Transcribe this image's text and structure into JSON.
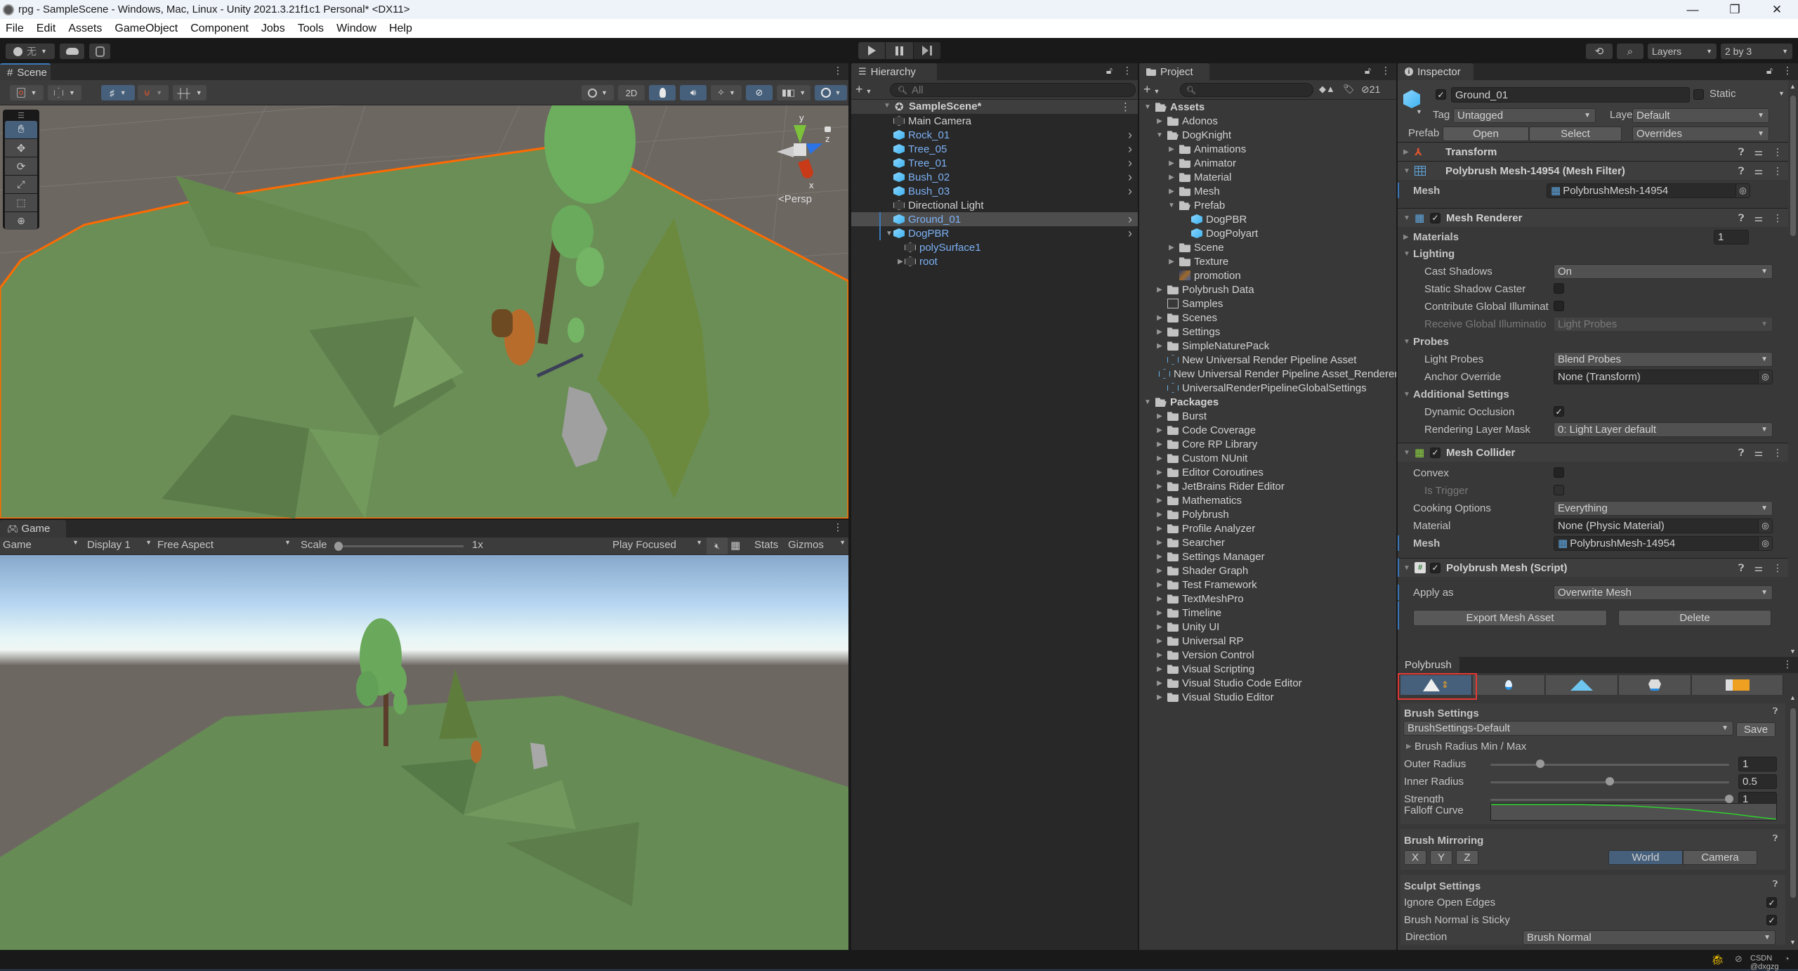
{
  "window": {
    "title": "rpg - SampleScene - Windows, Mac, Linux - Unity 2021.3.21f1c1 Personal* <DX11>",
    "controls": {
      "minimize": "—",
      "maximize": "❐",
      "close": "✕"
    }
  },
  "menu": [
    "File",
    "Edit",
    "Assets",
    "GameObject",
    "Component",
    "Jobs",
    "Tools",
    "Window",
    "Help"
  ],
  "toolbar": {
    "account_label": "无",
    "play_icon": "play-icon",
    "pause_icon": "pause-icon",
    "step_icon": "step-icon",
    "layers_label": "Layers",
    "layout_label": "2 by 3"
  },
  "scene": {
    "tab_label": "Scene",
    "mode_2d": "2D",
    "persp_label": "<Persp",
    "gizmo_axes": {
      "x": "x",
      "y": "y",
      "z": "z"
    },
    "tools": [
      "hand-tool",
      "move-tool",
      "rotate-tool",
      "scale-tool",
      "rect-tool",
      "transform-tool"
    ],
    "active_tool": "hand-tool",
    "selection_outline_color": "#ff6a00",
    "ground_color": "#6a8e56",
    "background_color": "#6d6762"
  },
  "game": {
    "tab_label": "Game",
    "view_select": "Game",
    "display_select": "Display 1",
    "aspect_select": "Free Aspect",
    "scale_label": "Scale",
    "scale_value": "1x",
    "scale_fraction": 0.0,
    "play_mode": "Play Focused",
    "stats_label": "Stats",
    "gizmos_label": "Gizmos"
  },
  "hierarchy": {
    "tab_label": "Hierarchy",
    "search_placeholder": "All",
    "scene_name": "SampleScene*",
    "items": [
      {
        "label": "Main Camera",
        "prefab": false,
        "depth": 1
      },
      {
        "label": "Rock_01",
        "prefab": true,
        "depth": 1,
        "has_arrow": true
      },
      {
        "label": "Tree_05",
        "prefab": true,
        "depth": 1,
        "has_arrow": true
      },
      {
        "label": "Tree_01",
        "prefab": true,
        "depth": 1,
        "has_arrow": true
      },
      {
        "label": "Bush_02",
        "prefab": true,
        "depth": 1,
        "has_arrow": true
      },
      {
        "label": "Bush_03",
        "prefab": true,
        "depth": 1,
        "has_arrow": true
      },
      {
        "label": "Directional Light",
        "prefab": false,
        "depth": 1
      },
      {
        "label": "Ground_01",
        "prefab": true,
        "depth": 1,
        "has_arrow": true,
        "selected": true
      },
      {
        "label": "DogPBR",
        "prefab": true,
        "depth": 1,
        "has_arrow": true,
        "expanded": true
      },
      {
        "label": "polySurface1",
        "prefab": false,
        "depth": 2,
        "blue": true
      },
      {
        "label": "root",
        "prefab": false,
        "depth": 2,
        "blue": true,
        "collapsed": true
      }
    ]
  },
  "project": {
    "tab_label": "Project",
    "search_placeholder": "",
    "hidden_count": "21",
    "tree": [
      {
        "label": "Assets",
        "depth": 0,
        "type": "folder-open",
        "bold": true,
        "arrow": "down"
      },
      {
        "label": "Adonos",
        "depth": 1,
        "type": "folder",
        "arrow": "right"
      },
      {
        "label": "DogKnight",
        "depth": 1,
        "type": "folder-open",
        "arrow": "down"
      },
      {
        "label": "Animations",
        "depth": 2,
        "type": "folder",
        "arrow": "right"
      },
      {
        "label": "Animator",
        "depth": 2,
        "type": "folder",
        "arrow": "right"
      },
      {
        "label": "Material",
        "depth": 2,
        "type": "folder",
        "arrow": "right"
      },
      {
        "label": "Mesh",
        "depth": 2,
        "type": "folder",
        "arrow": "right"
      },
      {
        "label": "Prefab",
        "depth": 2,
        "type": "folder-open",
        "arrow": "down"
      },
      {
        "label": "DogPBR",
        "depth": 3,
        "type": "prefab"
      },
      {
        "label": "DogPolyart",
        "depth": 3,
        "type": "prefab"
      },
      {
        "label": "Scene",
        "depth": 2,
        "type": "folder",
        "arrow": "right"
      },
      {
        "label": "Texture",
        "depth": 2,
        "type": "folder",
        "arrow": "right"
      },
      {
        "label": "promotion",
        "depth": 2,
        "type": "image"
      },
      {
        "label": "Polybrush Data",
        "depth": 1,
        "type": "folder",
        "arrow": "right"
      },
      {
        "label": "Samples",
        "depth": 1,
        "type": "folder-empty"
      },
      {
        "label": "Scenes",
        "depth": 1,
        "type": "folder",
        "arrow": "right"
      },
      {
        "label": "Settings",
        "depth": 1,
        "type": "folder",
        "arrow": "right"
      },
      {
        "label": "SimpleNaturePack",
        "depth": 1,
        "type": "folder",
        "arrow": "right"
      },
      {
        "label": "New Universal Render Pipeline Asset",
        "depth": 1,
        "type": "urp"
      },
      {
        "label": "New Universal Render Pipeline Asset_Renderer",
        "depth": 1,
        "type": "urp"
      },
      {
        "label": "UniversalRenderPipelineGlobalSettings",
        "depth": 1,
        "type": "urp"
      },
      {
        "label": "Packages",
        "depth": 0,
        "type": "folder-open",
        "bold": true,
        "arrow": "down"
      },
      {
        "label": "Burst",
        "depth": 1,
        "type": "folder",
        "arrow": "right"
      },
      {
        "label": "Code Coverage",
        "depth": 1,
        "type": "folder",
        "arrow": "right"
      },
      {
        "label": "Core RP Library",
        "depth": 1,
        "type": "folder",
        "arrow": "right"
      },
      {
        "label": "Custom NUnit",
        "depth": 1,
        "type": "folder",
        "arrow": "right"
      },
      {
        "label": "Editor Coroutines",
        "depth": 1,
        "type": "folder",
        "arrow": "right"
      },
      {
        "label": "JetBrains Rider Editor",
        "depth": 1,
        "type": "folder",
        "arrow": "right"
      },
      {
        "label": "Mathematics",
        "depth": 1,
        "type": "folder",
        "arrow": "right"
      },
      {
        "label": "Polybrush",
        "depth": 1,
        "type": "folder",
        "arrow": "right"
      },
      {
        "label": "Profile Analyzer",
        "depth": 1,
        "type": "folder",
        "arrow": "right"
      },
      {
        "label": "Searcher",
        "depth": 1,
        "type": "folder",
        "arrow": "right"
      },
      {
        "label": "Settings Manager",
        "depth": 1,
        "type": "folder",
        "arrow": "right"
      },
      {
        "label": "Shader Graph",
        "depth": 1,
        "type": "folder",
        "arrow": "right"
      },
      {
        "label": "Test Framework",
        "depth": 1,
        "type": "folder",
        "arrow": "right"
      },
      {
        "label": "TextMeshPro",
        "depth": 1,
        "type": "folder",
        "arrow": "right"
      },
      {
        "label": "Timeline",
        "depth": 1,
        "type": "folder",
        "arrow": "right"
      },
      {
        "label": "Unity UI",
        "depth": 1,
        "type": "folder",
        "arrow": "right"
      },
      {
        "label": "Universal RP",
        "depth": 1,
        "type": "folder",
        "arrow": "right"
      },
      {
        "label": "Version Control",
        "depth": 1,
        "type": "folder",
        "arrow": "right"
      },
      {
        "label": "Visual Scripting",
        "depth": 1,
        "type": "folder",
        "arrow": "right"
      },
      {
        "label": "Visual Studio Code Editor",
        "depth": 1,
        "type": "folder",
        "arrow": "right"
      },
      {
        "label": "Visual Studio Editor",
        "depth": 1,
        "type": "folder",
        "arrow": "right"
      }
    ]
  },
  "inspector": {
    "tab_label": "Inspector",
    "object_name": "Ground_01",
    "active": true,
    "static_label": "Static",
    "static": false,
    "tag_label": "Tag",
    "tag_value": "Untagged",
    "layer_label": "Layer",
    "layer_value": "Default",
    "prefab_label": "Prefab",
    "prefab_open": "Open",
    "prefab_select": "Select",
    "prefab_overrides": "Overrides",
    "transform": {
      "title": "Transform"
    },
    "mesh_filter": {
      "title": "Polybrush Mesh-14954 (Mesh Filter)",
      "mesh_label": "Mesh",
      "mesh_value": "PolybrushMesh-14954"
    },
    "mesh_renderer": {
      "title": "Mesh Renderer",
      "enabled": true,
      "materials_label": "Materials",
      "materials_count": "1",
      "lighting_label": "Lighting",
      "cast_shadows_label": "Cast Shadows",
      "cast_shadows_value": "On",
      "static_shadow_caster_label": "Static Shadow Caster",
      "static_shadow_caster": false,
      "contribute_gi_label": "Contribute Global Illuminat",
      "contribute_gi": false,
      "receive_gi_label": "Receive Global Illuminatio",
      "receive_gi_value": "Light Probes",
      "probes_label": "Probes",
      "light_probes_label": "Light Probes",
      "light_probes_value": "Blend Probes",
      "anchor_override_label": "Anchor Override",
      "anchor_override_value": "None (Transform)",
      "additional_settings_label": "Additional Settings",
      "dynamic_occlusion_label": "Dynamic Occlusion",
      "dynamic_occlusion": true,
      "rendering_layer_mask_label": "Rendering Layer Mask",
      "rendering_layer_mask_value": "0: Light Layer default"
    },
    "mesh_collider": {
      "title": "Mesh Collider",
      "enabled": true,
      "convex_label": "Convex",
      "convex": false,
      "is_trigger_label": "Is Trigger",
      "is_trigger": false,
      "cooking_options_label": "Cooking Options",
      "cooking_options_value": "Everything",
      "material_label": "Material",
      "material_value": "None (Physic Material)",
      "mesh_label": "Mesh",
      "mesh_value": "PolybrushMesh-14954"
    },
    "polybrush_mesh": {
      "title": "Polybrush Mesh (Script)",
      "enabled": true,
      "apply_as_label": "Apply as",
      "apply_as_value": "Overwrite Mesh",
      "export_button": "Export Mesh Asset",
      "delete_button": "Delete"
    }
  },
  "polybrush": {
    "tab_label": "Polybrush",
    "modes": [
      "sculpt-mode",
      "smooth-mode",
      "paint-vertex-mode",
      "scatter-prefab-mode",
      "paint-texture-mode"
    ],
    "active_mode": "sculpt-mode",
    "brush_settings_label": "Brush Settings",
    "brush_preset": "BrushSettings-Default",
    "save_label": "Save",
    "radius_minmax_label": "Brush Radius Min / Max",
    "outer_radius_label": "Outer Radius",
    "outer_radius_value": "1",
    "outer_radius_fraction": 0.21,
    "inner_radius_label": "Inner Radius",
    "inner_radius_value": "0.5",
    "inner_radius_fraction": 0.5,
    "strength_label": "Strength",
    "strength_value": "1",
    "strength_fraction": 1.0,
    "falloff_label": "Falloff Curve",
    "mirroring_label": "Brush Mirroring",
    "mirror_axes": [
      "X",
      "Y",
      "Z"
    ],
    "mirror_space_world": "World",
    "mirror_space_camera": "Camera",
    "mirror_space_active": "World",
    "sculpt_settings_label": "Sculpt Settings",
    "ignore_open_edges_label": "Ignore Open Edges",
    "ignore_open_edges": true,
    "brush_normal_sticky_label": "Brush Normal is Sticky",
    "brush_normal_sticky": true,
    "direction_label": "Direction",
    "direction_value": "Brush Normal",
    "highlight_color": "#e53935"
  },
  "statusbar": {
    "watermark": "CSDN @dxgzg"
  }
}
